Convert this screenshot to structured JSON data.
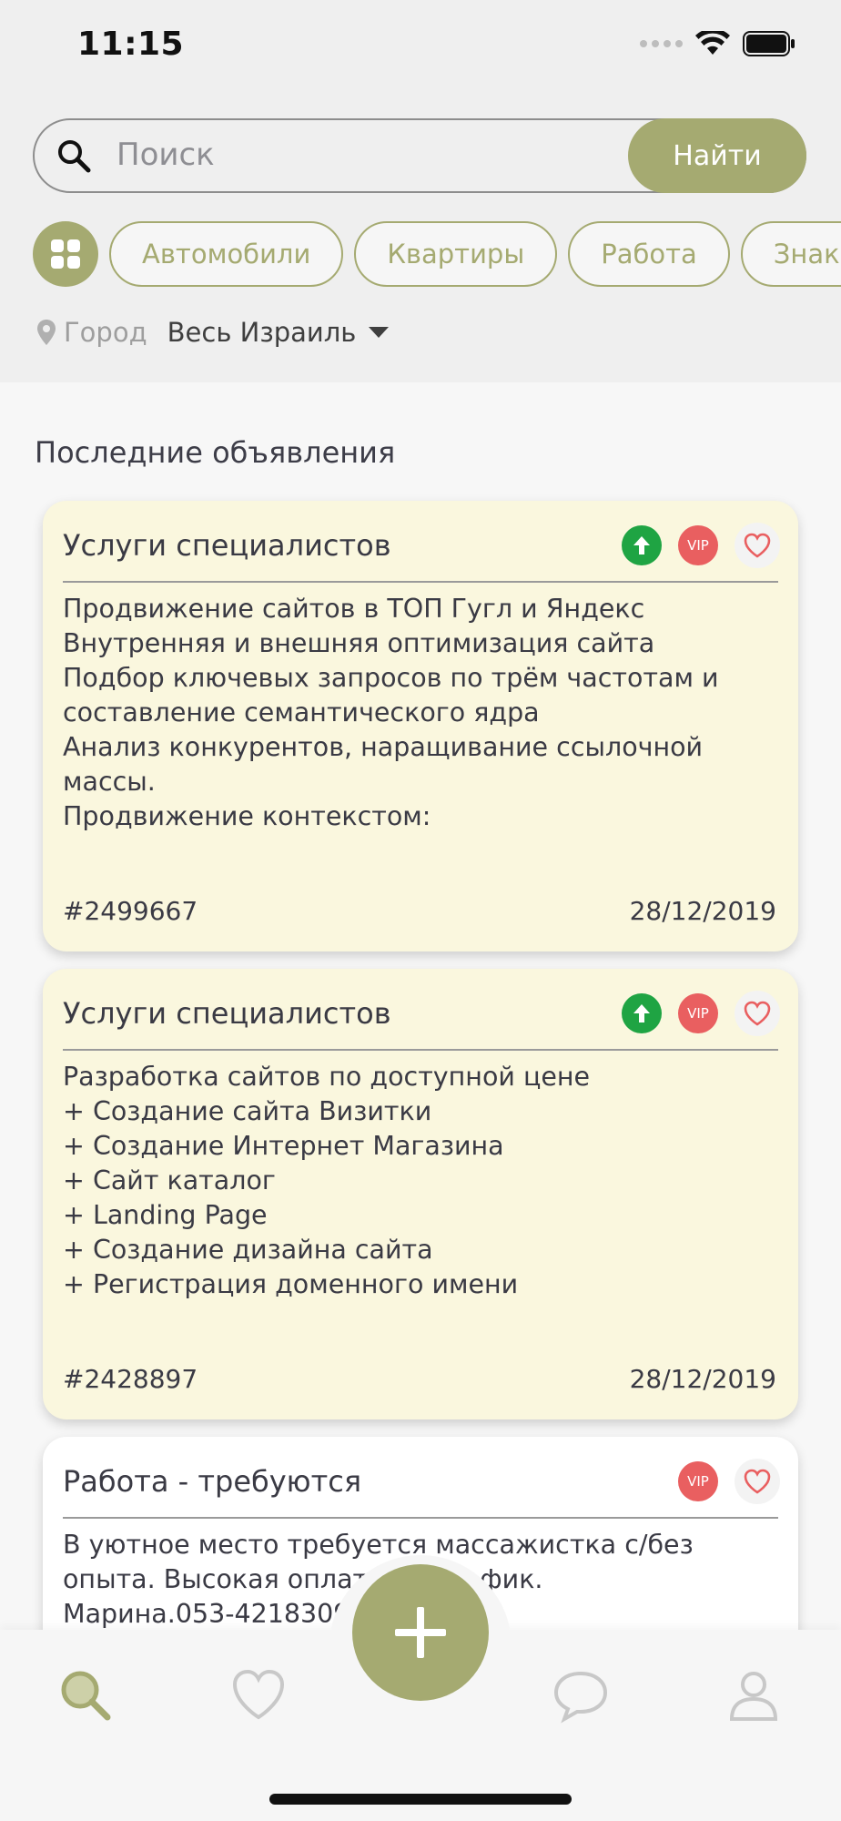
{
  "status_bar": {
    "time": "11:15"
  },
  "search": {
    "placeholder": "Поиск",
    "button_label": "Найти"
  },
  "categories": [
    "Автомобили",
    "Квартиры",
    "Работа",
    "Знак"
  ],
  "city": {
    "label": "Город",
    "value": "Весь Израиль"
  },
  "section_title": "Последние объявления",
  "listings": [
    {
      "category": "Услуги специалистов",
      "has_up": true,
      "vip_label": "VIP",
      "body": [
        "Продвижение сайтов в ТОП Гугл и Яндекс",
        "Внутренняя и внешняя оптимизация сайта",
        "Подбор ключевых запросов по трём частотам и",
        "составление семантического ядра",
        "Анализ конкурентов, наращивание ссылочной",
        "массы.",
        "Продвижение контекстом:"
      ],
      "id": "#2499667",
      "date": "28/12/2019"
    },
    {
      "category": "Услуги специалистов",
      "has_up": true,
      "vip_label": "VIP",
      "body": [
        "Разработка сайтов по доступной цене",
        "+ Создание сайта Визитки",
        "+ Создание Интернет Магазина",
        "+ Сайт каталог",
        "+ Landing Page",
        "+ Создание дизайна сайта",
        "+ Регистрация доменного имени"
      ],
      "id": "#2428897",
      "date": "28/12/2019"
    },
    {
      "category": "Работа - требуются",
      "has_up": false,
      "vip_label": "VIP",
      "body": [
        "В уютное место требуется массажистка с/без",
        "опыта. Высокая оплата ий график.",
        "Марина.053-4218309"
      ]
    }
  ],
  "tabbar": {
    "items": [
      "search-icon",
      "heart-icon",
      "add-icon",
      "chat-icon",
      "profile-icon"
    ],
    "active": "search-icon"
  },
  "colors": {
    "accent": "#a5aa71",
    "card_highlight": "#faf7de",
    "up_badge": "#1fa443",
    "vip_badge": "#e95f60"
  }
}
